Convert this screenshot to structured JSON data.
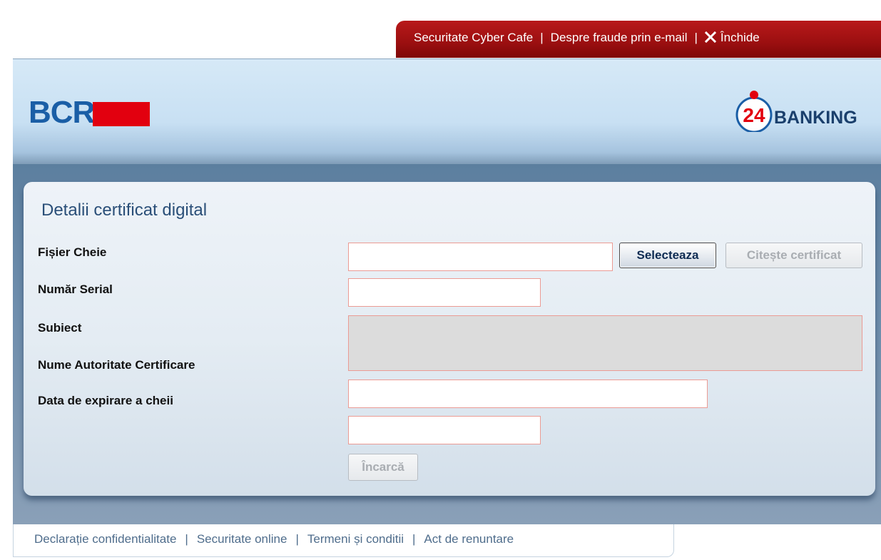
{
  "top_nav": {
    "cyber_cafe": "Securitate Cyber Cafe",
    "email_fraud": "Despre fraude prin e-mail",
    "close": "Închide",
    "separator": "|"
  },
  "header": {
    "bank_logo_text": "BCR",
    "service_logo_number": "24",
    "service_logo_text": "BANKING"
  },
  "form": {
    "title": "Detalii certificat digital",
    "labels": {
      "key_file": "Fișier Cheie",
      "serial_number": "Număr Serial",
      "subject": "Subiect",
      "ca_name": "Nume Autoritate Certificare",
      "expiry_date": "Data de expirare a cheii"
    },
    "values": {
      "key_file": "",
      "serial_number": "",
      "subject": "",
      "expiry_date": "",
      "extra": ""
    },
    "buttons": {
      "select": "Selecteaza",
      "read_certificate": "Citește certificat",
      "upload": "Încarcă"
    }
  },
  "footer": {
    "privacy": "Declarație confidentialitate",
    "online_security": "Securitate online",
    "terms": "Termeni și conditii",
    "disclaimer": "Act de renuntare",
    "separator": "|"
  },
  "colors": {
    "top_tab_red": "#9b0f10",
    "bcr_blue": "#1a5ea6",
    "bcr_red": "#e2000f",
    "title_blue": "#2a4f78",
    "field_border": "#eb9b94",
    "footer_link": "#4f6d8c"
  }
}
